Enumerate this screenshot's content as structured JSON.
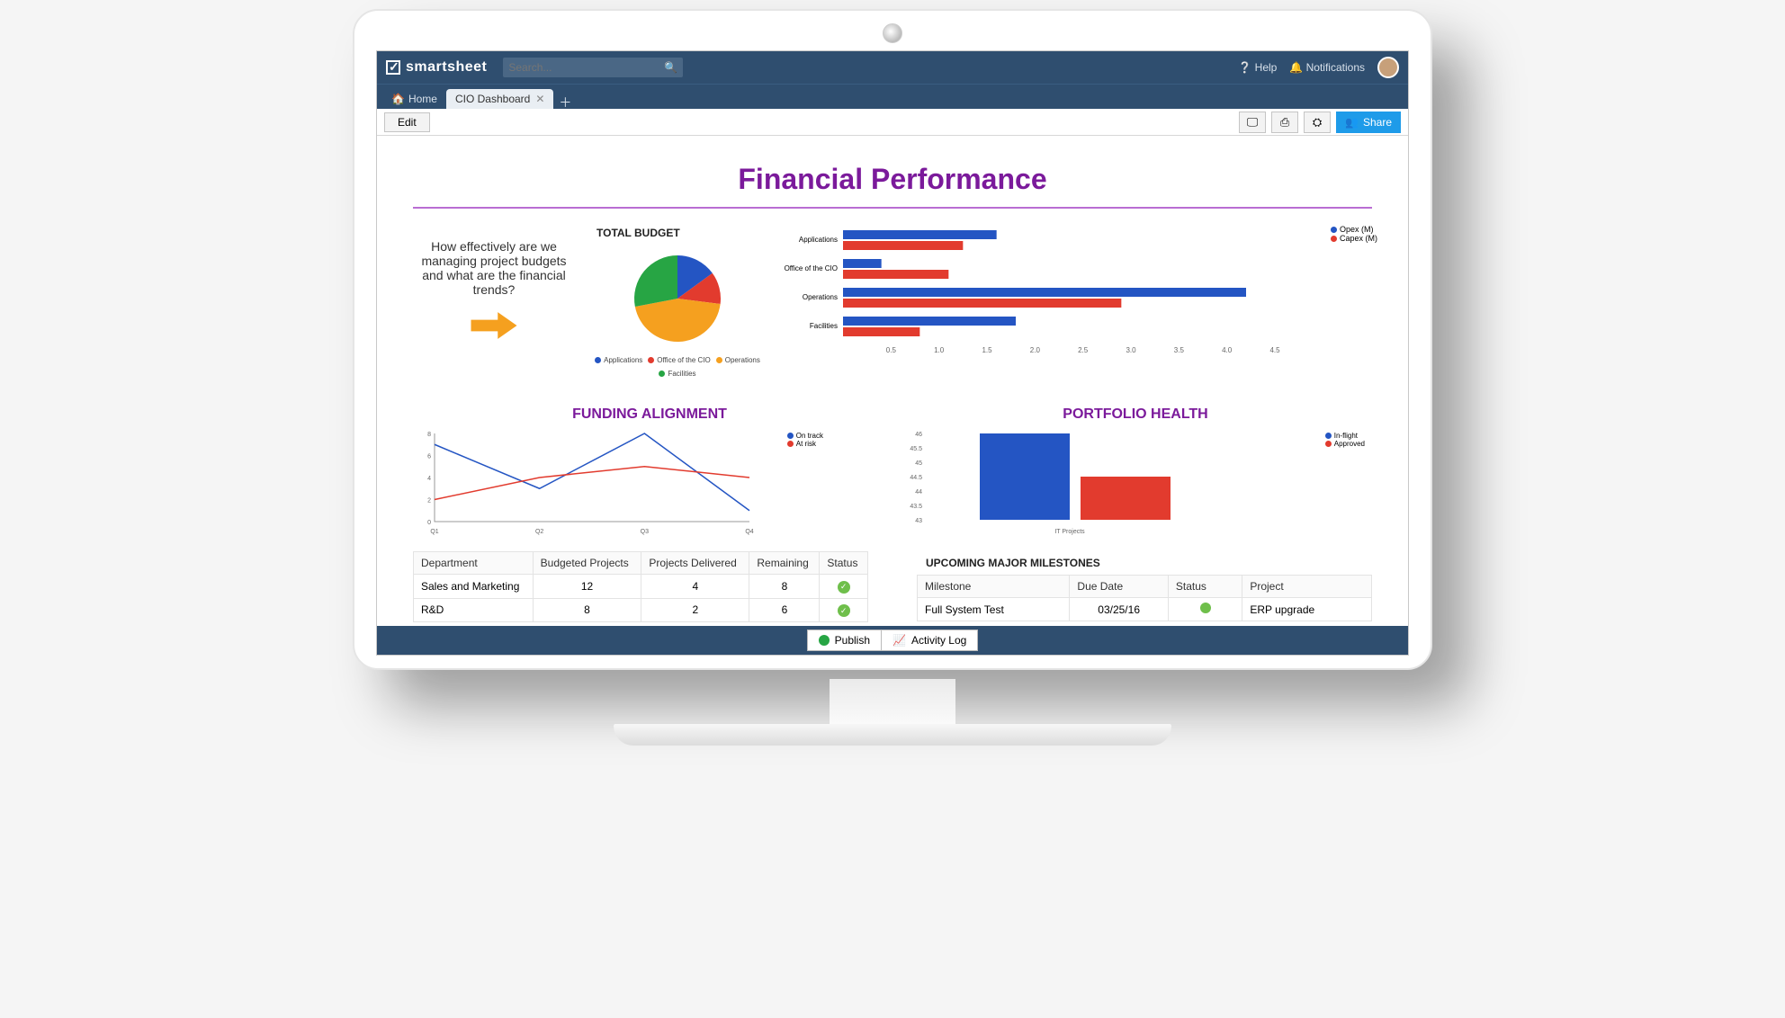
{
  "brand": "smartsheet",
  "search": {
    "placeholder": "Search..."
  },
  "top_right": {
    "help": "Help",
    "notifications": "Notifications"
  },
  "tabs": {
    "home": "Home",
    "active": "CIO Dashboard"
  },
  "toolbar": {
    "edit": "Edit",
    "share": "Share"
  },
  "dashboard": {
    "title": "Financial Performance",
    "callout_text": "How effectively are we managing project budgets and what are the financial trends?",
    "total_budget_title": "TOTAL BUDGET",
    "funding_title": "FUNDING ALIGNMENT",
    "portfolio_title": "PORTFOLIO HEALTH",
    "milestones_title": "UPCOMING MAJOR MILESTONES"
  },
  "pie_legend": [
    "Applications",
    "Office of the CIO",
    "Operations",
    "Facilities"
  ],
  "bar_legend": [
    "Opex (M)",
    "Capex (M)"
  ],
  "line_legend": [
    "On track",
    "At risk"
  ],
  "portfolio_legend": [
    "In-flight",
    "Approved"
  ],
  "dept_table": {
    "headers": [
      "Department",
      "Budgeted Projects",
      "Projects Delivered",
      "Remaining",
      "Status"
    ],
    "rows": [
      {
        "c0": "Sales and Marketing",
        "c1": "12",
        "c2": "4",
        "c3": "8",
        "status": "ok"
      },
      {
        "c0": "R&D",
        "c1": "8",
        "c2": "2",
        "c3": "6",
        "status": "ok"
      }
    ]
  },
  "milestones": {
    "headers": [
      "Milestone",
      "Due Date",
      "Status",
      "Project"
    ],
    "rows": [
      {
        "c0": "Full System Test",
        "c1": "03/25/16",
        "color": "#6fbf4b",
        "c3": "ERP upgrade"
      }
    ]
  },
  "footer": {
    "publish": "Publish",
    "activity": "Activity Log"
  },
  "chart_data": [
    {
      "type": "pie",
      "title": "TOTAL BUDGET",
      "series": [
        {
          "name": "Applications",
          "value": 15,
          "color": "#2455c3"
        },
        {
          "name": "Office of the CIO",
          "value": 12,
          "color": "#e23b2e"
        },
        {
          "name": "Operations",
          "value": 45,
          "color": "#f5a01f"
        },
        {
          "name": "Facilities",
          "value": 28,
          "color": "#27a544"
        }
      ]
    },
    {
      "type": "bar",
      "orientation": "horizontal",
      "title": "",
      "categories": [
        "Applications",
        "Office of the CIO",
        "Operations",
        "Facilities"
      ],
      "series": [
        {
          "name": "Opex (M)",
          "color": "#2455c3",
          "values": [
            1.6,
            0.4,
            4.2,
            1.8
          ]
        },
        {
          "name": "Capex (M)",
          "color": "#e23b2e",
          "values": [
            1.25,
            1.1,
            2.9,
            0.8
          ]
        }
      ],
      "xlim": [
        0.5,
        4.5
      ],
      "x_ticks": [
        0.5,
        1.0,
        1.5,
        2.0,
        2.5,
        3.0,
        3.5,
        4.0,
        4.5
      ]
    },
    {
      "type": "line",
      "title": "FUNDING ALIGNMENT",
      "x": [
        "Q1",
        "Q2",
        "Q3",
        "Q4"
      ],
      "series": [
        {
          "name": "On track",
          "color": "#2455c3",
          "values": [
            7,
            3,
            8,
            1
          ]
        },
        {
          "name": "At risk",
          "color": "#e23b2e",
          "values": [
            2,
            4,
            5,
            4
          ]
        }
      ],
      "ylim": [
        0,
        8
      ]
    },
    {
      "type": "bar",
      "title": "PORTFOLIO HEALTH",
      "categories": [
        "IT Projects"
      ],
      "series": [
        {
          "name": "In-flight",
          "color": "#2455c3",
          "values": [
            46
          ]
        },
        {
          "name": "Approved",
          "color": "#e23b2e",
          "values": [
            44.5
          ]
        }
      ],
      "ylim": [
        43,
        46
      ],
      "y_ticks": [
        43,
        43.5,
        44,
        44.5,
        45,
        45.5,
        46
      ]
    }
  ]
}
